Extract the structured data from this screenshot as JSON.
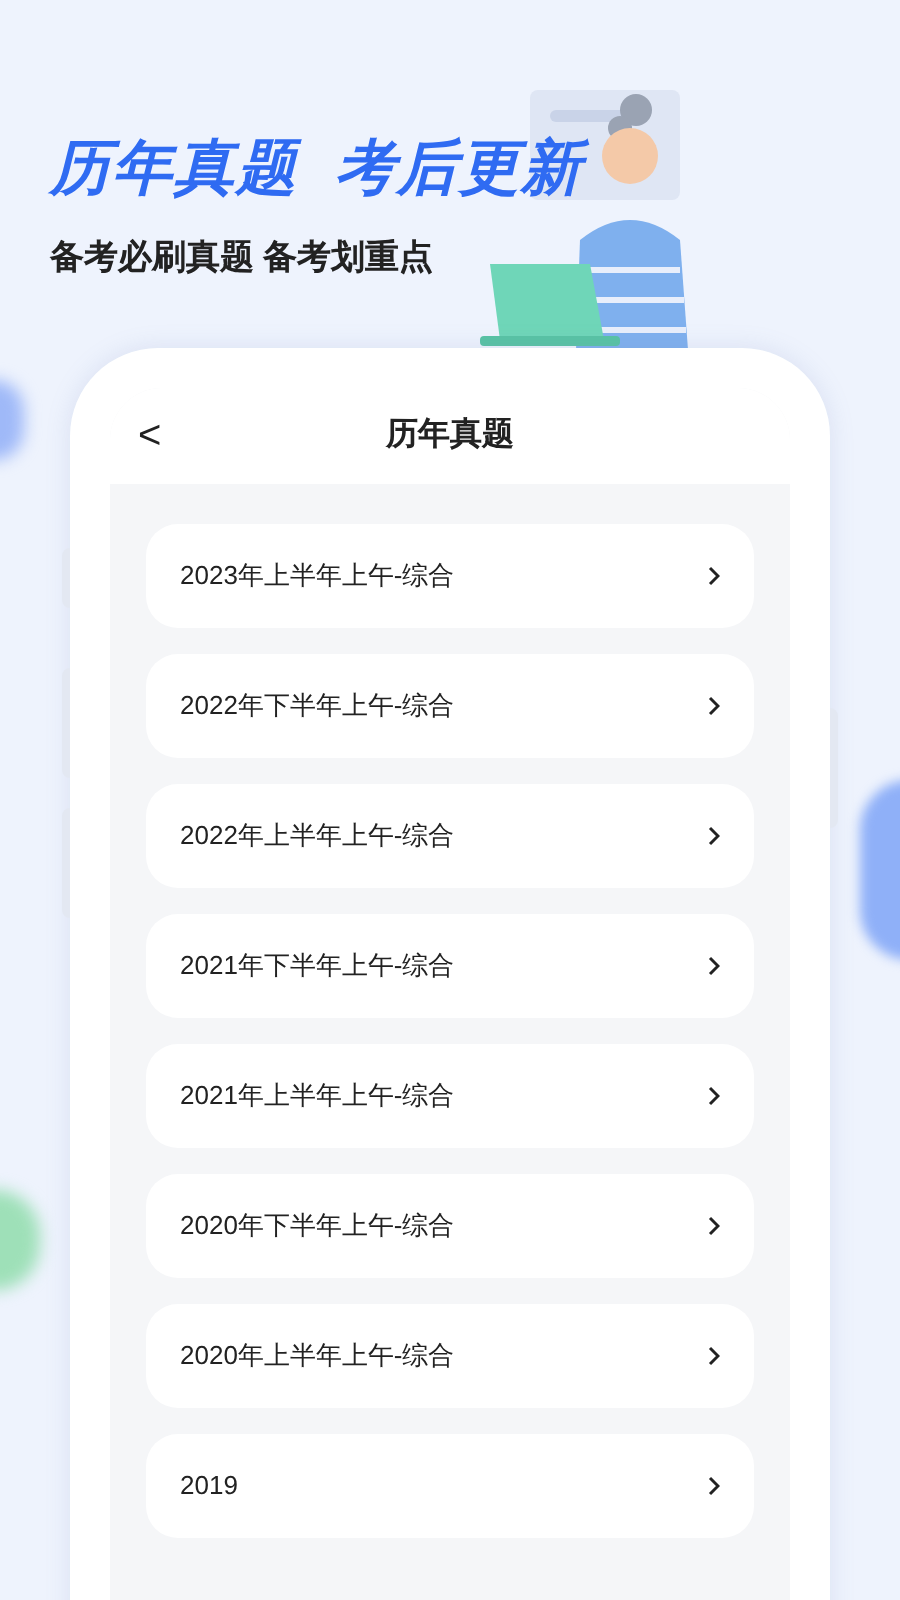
{
  "headline": "历年真题  考后更新",
  "subtitle": "备考必刷真题 备考划重点",
  "screen": {
    "title": "历年真题",
    "back": "<",
    "items": [
      {
        "label": "2023年上半年上午-综合"
      },
      {
        "label": "2022年下半年上午-综合"
      },
      {
        "label": "2022年上半年上午-综合"
      },
      {
        "label": "2021年下半年上午-综合"
      },
      {
        "label": "2021年上半年上午-综合"
      },
      {
        "label": "2020年下半年上午-综合"
      },
      {
        "label": "2020年上半年上午-综合"
      },
      {
        "label": "2019"
      }
    ]
  }
}
